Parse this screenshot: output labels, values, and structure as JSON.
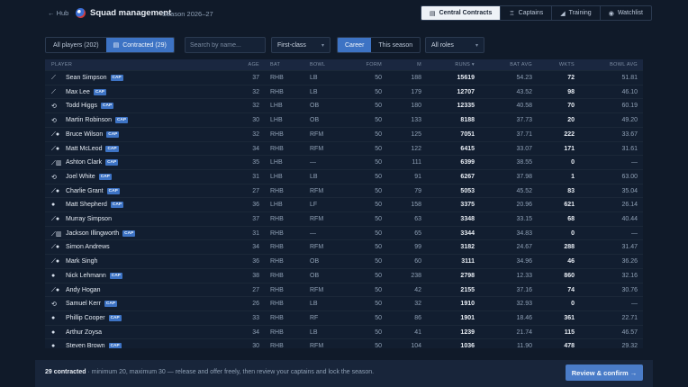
{
  "header": {
    "back_label": "← Hub",
    "title": "Squad management",
    "season": "Season 2026–27",
    "tabs": [
      {
        "label": "Central Contracts",
        "icon": "document-icon"
      },
      {
        "label": "Captains",
        "icon": "trophy-icon"
      },
      {
        "label": "Training",
        "icon": "chart-icon"
      },
      {
        "label": "Watchlist",
        "icon": "eye-icon"
      }
    ]
  },
  "filters": {
    "players_all": "All players (202)",
    "players_contracted": "Contracted (29)",
    "search_placeholder": "Search by name...",
    "format_select": "First-class",
    "stat_career": "Career",
    "stat_season": "This season",
    "roles_select": "All roles"
  },
  "table": {
    "columns": [
      "PLAYER",
      "AGE",
      "BAT",
      "BOWL",
      "FORM",
      "M",
      "RUNS ▾",
      "BAT AVG",
      "WKTS",
      "BOWL AVG"
    ],
    "cap_label": "CAP",
    "rows": [
      {
        "icon": "bat-icon",
        "glyph": "⟋",
        "name": "Sean Simpson",
        "cap": true,
        "age": "37",
        "bat": "RHB",
        "bowl": "LB",
        "form": "50",
        "m": "188",
        "runs": "15619",
        "bat_avg": "54.23",
        "wkts": "72",
        "bowl_avg": "51.81"
      },
      {
        "icon": "bat-icon",
        "glyph": "⟋",
        "name": "Max Lee",
        "cap": true,
        "age": "32",
        "bat": "RHB",
        "bowl": "LB",
        "form": "50",
        "m": "179",
        "runs": "12707",
        "bat_avg": "43.52",
        "wkts": "98",
        "bowl_avg": "46.10"
      },
      {
        "icon": "wicketkeeper-icon",
        "glyph": "⟲",
        "name": "Todd Higgs",
        "cap": true,
        "age": "32",
        "bat": "LHB",
        "bowl": "OB",
        "form": "50",
        "m": "180",
        "runs": "12335",
        "bat_avg": "40.58",
        "wkts": "70",
        "bowl_avg": "60.19"
      },
      {
        "icon": "wicketkeeper-icon",
        "glyph": "⟲",
        "name": "Martin Robinson",
        "cap": true,
        "age": "30",
        "bat": "LHB",
        "bowl": "OB",
        "form": "50",
        "m": "133",
        "runs": "8188",
        "bat_avg": "37.73",
        "wkts": "20",
        "bowl_avg": "49.20"
      },
      {
        "icon": "allrounder-icon",
        "glyph": "⟋●",
        "name": "Bruce Wilson",
        "cap": true,
        "age": "32",
        "bat": "RHB",
        "bowl": "RFM",
        "form": "50",
        "m": "125",
        "runs": "7051",
        "bat_avg": "37.71",
        "wkts": "222",
        "bowl_avg": "33.67"
      },
      {
        "icon": "allrounder-icon",
        "glyph": "⟋●",
        "name": "Matt McLeod",
        "cap": true,
        "age": "34",
        "bat": "RHB",
        "bowl": "RFM",
        "form": "50",
        "m": "122",
        "runs": "6415",
        "bat_avg": "33.07",
        "wkts": "171",
        "bowl_avg": "31.61"
      },
      {
        "icon": "bat-keeper-icon",
        "glyph": "⟋▥",
        "name": "Ashton Clark",
        "cap": true,
        "age": "35",
        "bat": "LHB",
        "bowl": "—",
        "form": "50",
        "m": "111",
        "runs": "6399",
        "bat_avg": "38.55",
        "wkts": "0",
        "bowl_avg": "—"
      },
      {
        "icon": "wicketkeeper-icon",
        "glyph": "⟲",
        "name": "Joel White",
        "cap": true,
        "age": "31",
        "bat": "LHB",
        "bowl": "LB",
        "form": "50",
        "m": "91",
        "runs": "6267",
        "bat_avg": "37.98",
        "wkts": "1",
        "bowl_avg": "63.00"
      },
      {
        "icon": "allrounder-icon",
        "glyph": "⟋●",
        "name": "Charlie Grant",
        "cap": true,
        "age": "27",
        "bat": "RHB",
        "bowl": "RFM",
        "form": "50",
        "m": "79",
        "runs": "5053",
        "bat_avg": "45.52",
        "wkts": "83",
        "bowl_avg": "35.04"
      },
      {
        "icon": "ball-icon",
        "glyph": "●",
        "name": "Matt Shepherd",
        "cap": true,
        "age": "36",
        "bat": "LHB",
        "bowl": "LF",
        "form": "50",
        "m": "158",
        "runs": "3375",
        "bat_avg": "20.96",
        "wkts": "621",
        "bowl_avg": "26.14"
      },
      {
        "icon": "allrounder-icon",
        "glyph": "⟋●",
        "name": "Murray Simpson",
        "cap": false,
        "age": "37",
        "bat": "RHB",
        "bowl": "RFM",
        "form": "50",
        "m": "63",
        "runs": "3348",
        "bat_avg": "33.15",
        "wkts": "68",
        "bowl_avg": "40.44"
      },
      {
        "icon": "bat-keeper-icon",
        "glyph": "⟋▥",
        "name": "Jackson Illingworth",
        "cap": true,
        "age": "31",
        "bat": "RHB",
        "bowl": "—",
        "form": "50",
        "m": "65",
        "runs": "3344",
        "bat_avg": "34.83",
        "wkts": "0",
        "bowl_avg": "—"
      },
      {
        "icon": "allrounder-icon",
        "glyph": "⟋●",
        "name": "Simon Andrews",
        "cap": false,
        "age": "34",
        "bat": "RHB",
        "bowl": "RFM",
        "form": "50",
        "m": "99",
        "runs": "3182",
        "bat_avg": "24.67",
        "wkts": "288",
        "bowl_avg": "31.47"
      },
      {
        "icon": "allrounder-icon",
        "glyph": "⟋●",
        "name": "Mark Singh",
        "cap": false,
        "age": "36",
        "bat": "RHB",
        "bowl": "OB",
        "form": "50",
        "m": "60",
        "runs": "3111",
        "bat_avg": "34.96",
        "wkts": "46",
        "bowl_avg": "36.26"
      },
      {
        "icon": "ball-icon",
        "glyph": "●",
        "name": "Nick Lehmann",
        "cap": true,
        "age": "38",
        "bat": "RHB",
        "bowl": "OB",
        "form": "50",
        "m": "238",
        "runs": "2798",
        "bat_avg": "12.33",
        "wkts": "860",
        "bowl_avg": "32.16"
      },
      {
        "icon": "allrounder-icon",
        "glyph": "⟋●",
        "name": "Andy Hogan",
        "cap": false,
        "age": "27",
        "bat": "RHB",
        "bowl": "RFM",
        "form": "50",
        "m": "42",
        "runs": "2155",
        "bat_avg": "37.16",
        "wkts": "74",
        "bowl_avg": "30.76"
      },
      {
        "icon": "wicketkeeper-icon",
        "glyph": "⟲",
        "name": "Samuel Kerr",
        "cap": true,
        "age": "26",
        "bat": "RHB",
        "bowl": "LB",
        "form": "50",
        "m": "32",
        "runs": "1910",
        "bat_avg": "32.93",
        "wkts": "0",
        "bowl_avg": "—"
      },
      {
        "icon": "ball-icon",
        "glyph": "●",
        "name": "Phillip Cooper",
        "cap": true,
        "age": "33",
        "bat": "RHB",
        "bowl": "RF",
        "form": "50",
        "m": "86",
        "runs": "1901",
        "bat_avg": "18.46",
        "wkts": "361",
        "bowl_avg": "22.71"
      },
      {
        "icon": "ball-icon",
        "glyph": "●",
        "name": "Arthur Zoysa",
        "cap": false,
        "age": "34",
        "bat": "RHB",
        "bowl": "LB",
        "form": "50",
        "m": "41",
        "runs": "1239",
        "bat_avg": "21.74",
        "wkts": "115",
        "bowl_avg": "46.57"
      },
      {
        "icon": "ball-icon",
        "glyph": "●",
        "name": "Steven Brown",
        "cap": true,
        "age": "30",
        "bat": "RHB",
        "bowl": "RFM",
        "form": "50",
        "m": "104",
        "runs": "1036",
        "bat_avg": "11.90",
        "wkts": "478",
        "bowl_avg": "29.32"
      }
    ]
  },
  "footer": {
    "count": "29 contracted",
    "message": " · minimum 20, maximum 30 — release and offer freely, then review your captains and lock the season.",
    "cta": "Review & confirm →"
  }
}
